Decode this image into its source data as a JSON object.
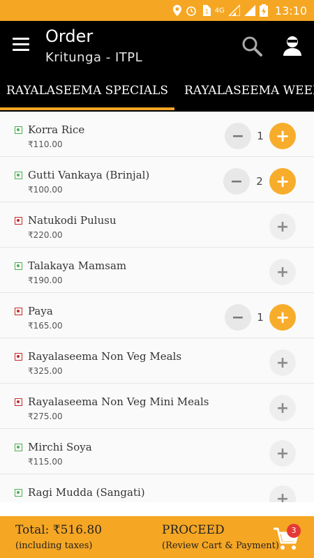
{
  "status_bar": {
    "time": "13:10",
    "network": "4G",
    "icons": [
      "location-icon",
      "alarm-icon",
      "sim-icon",
      "signal-icon",
      "battery-icon"
    ]
  },
  "app_bar": {
    "title": "Order",
    "subtitle": "Kritunga - ITPL",
    "icons": [
      "menu-icon",
      "search-icon",
      "user-icon"
    ]
  },
  "tabs": [
    {
      "label": "RAYALASEEMA SPECIALS",
      "active": true
    },
    {
      "label": "RAYALASEEMA WEEKEND SPECIALS",
      "active": false
    }
  ],
  "items": [
    {
      "name": "Korra Rice",
      "price": "₹110.00",
      "type": "veg",
      "qty": "1"
    },
    {
      "name": "Gutti Vankaya (Brinjal)",
      "price": "₹100.00",
      "type": "veg",
      "qty": "2"
    },
    {
      "name": "Natukodi Pulusu",
      "price": "₹220.00",
      "type": "non-veg",
      "qty": null
    },
    {
      "name": "Talakaya Mamsam",
      "price": "₹190.00",
      "type": "veg",
      "qty": null
    },
    {
      "name": "Paya",
      "price": "₹165.00",
      "type": "non-veg",
      "qty": "1"
    },
    {
      "name": "Rayalaseema Non Veg Meals",
      "price": "₹325.00",
      "type": "non-veg",
      "qty": null
    },
    {
      "name": "Rayalaseema Non Veg Mini Meals",
      "price": "₹275.00",
      "type": "non-veg",
      "qty": null
    },
    {
      "name": "Mirchi Soya",
      "price": "₹115.00",
      "type": "veg",
      "qty": null
    },
    {
      "name": "Ragi Mudda (Sangati)",
      "price": "",
      "type": "veg",
      "qty": null
    }
  ],
  "bottom": {
    "total": "Total: ₹516.80",
    "total_note": "(including taxes)",
    "proceed": "PROCEED",
    "proceed_note": "(Review Cart & Payment)",
    "cart_count": "3"
  },
  "colors": {
    "accent": "#f5a623",
    "veg": "#4caf50",
    "non_veg": "#c62828",
    "app_bar": "#000000"
  }
}
